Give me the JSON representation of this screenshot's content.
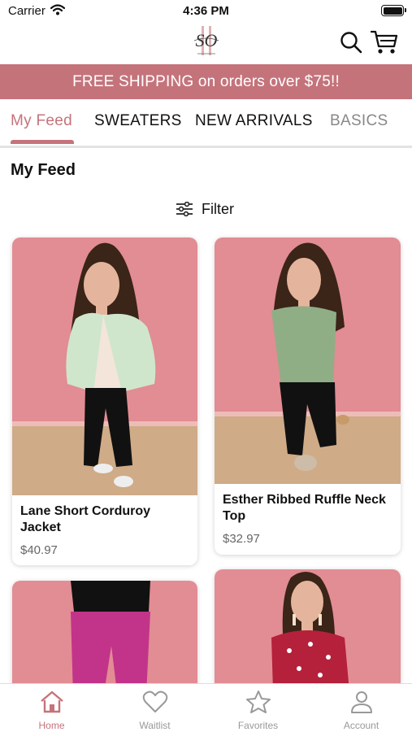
{
  "status_bar": {
    "carrier": "Carrier",
    "time": "4:36 PM"
  },
  "header": {
    "logo_icon": "boutique-logo",
    "search_icon": "search-icon",
    "cart_icon": "cart-icon"
  },
  "promo": {
    "text": "FREE SHIPPING on orders over $75!!"
  },
  "tabs": [
    {
      "label": "My Feed",
      "active": true
    },
    {
      "label": "SWEATERS"
    },
    {
      "label": "NEW ARRIVALS"
    },
    {
      "label": "BASICS"
    }
  ],
  "feed": {
    "title": "My Feed",
    "filter_label": "Filter",
    "products": [
      {
        "name": "Lane Short Corduroy Jacket",
        "price": "$40.97"
      },
      {
        "name": "Esther Ribbed Ruffle Neck Top",
        "price": "$32.97"
      },
      {
        "name": "",
        "price": ""
      },
      {
        "name": "",
        "price": ""
      }
    ]
  },
  "tabbar": [
    {
      "label": "Home",
      "icon": "home-icon",
      "active": true
    },
    {
      "label": "Waitlist",
      "icon": "heart-icon"
    },
    {
      "label": "Favorites",
      "icon": "star-icon"
    },
    {
      "label": "Account",
      "icon": "account-icon"
    }
  ],
  "colors": {
    "accent": "#c5737b",
    "photo_background": "#e28c94",
    "floor": "#cfab87"
  }
}
